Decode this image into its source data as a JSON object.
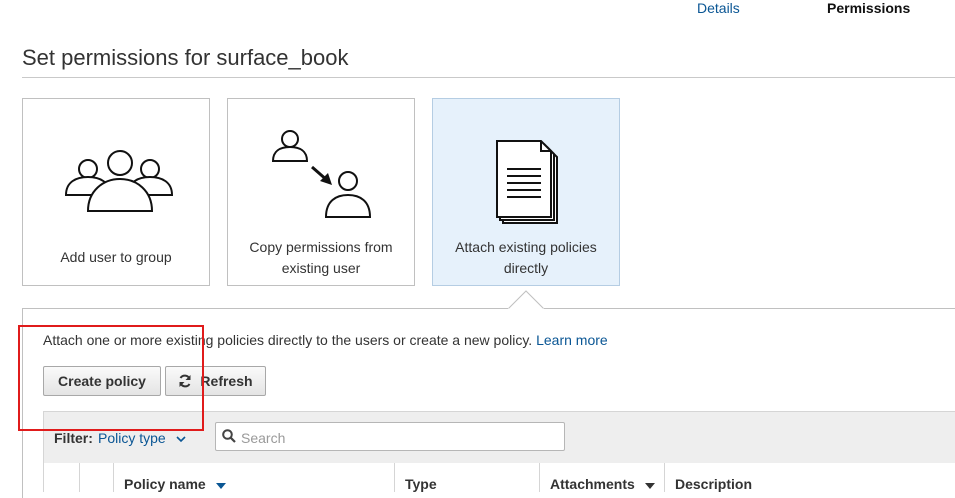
{
  "steps": {
    "details": "Details",
    "permissions": "Permissions"
  },
  "page": {
    "title": "Set permissions for surface_book"
  },
  "options": [
    {
      "label": "Add user to group",
      "icon": "group-users-icon"
    },
    {
      "label_line1": "Copy permissions from",
      "label_line2": "existing user",
      "icon": "copy-user-icon"
    },
    {
      "label_line1": "Attach existing policies",
      "label_line2": "directly",
      "icon": "policy-document-icon"
    }
  ],
  "panel": {
    "description": "Attach one or more existing policies directly to the users or create a new policy.",
    "learn_more": "Learn more",
    "create_policy": "Create policy",
    "refresh": "Refresh"
  },
  "filter": {
    "label": "Filter:",
    "value": "Policy type",
    "search_placeholder": "Search"
  },
  "table": {
    "columns": [
      "Policy name",
      "Type",
      "Attachments",
      "Description"
    ]
  },
  "colors": {
    "link": "#0a5694",
    "selected_card": "#e6f1fb",
    "highlight": "#e01b1b"
  }
}
